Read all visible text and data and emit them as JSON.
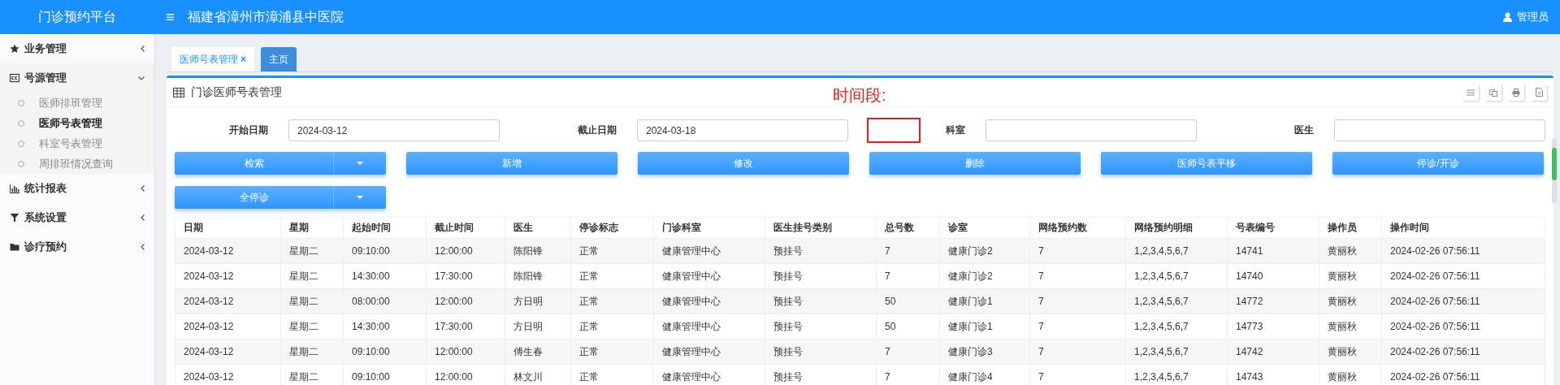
{
  "header": {
    "app_title": "门诊预约平台",
    "menu_glyph": "≡",
    "hospital": "福建省漳州市漳浦县中医院",
    "user": "管理员"
  },
  "sidebar": {
    "items": [
      {
        "label": "业务管理",
        "expanded": false
      },
      {
        "label": "号源管理",
        "expanded": true,
        "children": [
          {
            "label": "医师排班管理",
            "selected": false
          },
          {
            "label": "医师号表管理",
            "selected": true
          },
          {
            "label": "科室号表管理",
            "selected": false
          },
          {
            "label": "周排班情况查询",
            "selected": false
          }
        ]
      },
      {
        "label": "统计报表",
        "expanded": false
      },
      {
        "label": "系统设置",
        "expanded": false
      },
      {
        "label": "诊疗预约",
        "expanded": false
      }
    ]
  },
  "tabs": [
    {
      "label": "医师号表管理",
      "close": "×",
      "selected": true
    },
    {
      "label": "主页",
      "selected": false
    }
  ],
  "panel": {
    "title": "门诊医师号表管理",
    "filters": [
      {
        "label": "开始日期",
        "value": "2024-03-12"
      },
      {
        "label": "截止日期",
        "value": "2024-03-18"
      },
      {
        "label": "科室"
      },
      {
        "label": "医生"
      }
    ],
    "annotation": "时间段:",
    "buttons": [
      {
        "label": "检索",
        "kind": "split"
      },
      {
        "label": "新增",
        "kind": "plain"
      },
      {
        "label": "修改",
        "kind": "plain"
      },
      {
        "label": "删除",
        "kind": "plain"
      },
      {
        "label": "医师号表平移",
        "kind": "plain"
      },
      {
        "label": "停诊/开诊",
        "kind": "plain"
      },
      {
        "label": "全停诊",
        "kind": "split"
      }
    ],
    "table": {
      "columns": [
        "日期",
        "星期",
        "起始时间",
        "截止时间",
        "医生",
        "停诊标志",
        "门诊科室",
        "医生挂号类别",
        "总号数",
        "诊室",
        "网络预约数",
        "网络预约明细",
        "号表编号",
        "操作员",
        "操作时间"
      ],
      "rows": [
        [
          "2024-03-12",
          "星期二",
          "09:10:00",
          "12:00:00",
          "陈阳锋",
          "正常",
          "健康管理中心",
          "预挂号",
          "7",
          "健康门诊2",
          "7",
          "1,2,3,4,5,6,7",
          "14741",
          "黄丽秋",
          "2024-02-26 07:56:11"
        ],
        [
          "2024-03-12",
          "星期二",
          "14:30:00",
          "17:30:00",
          "陈阳锋",
          "正常",
          "健康管理中心",
          "预挂号",
          "7",
          "健康门诊2",
          "7",
          "1,2,3,4,5,6,7",
          "14740",
          "黄丽秋",
          "2024-02-26 07:56:11"
        ],
        [
          "2024-03-12",
          "星期二",
          "08:00:00",
          "12:00:00",
          "方日明",
          "正常",
          "健康管理中心",
          "预挂号",
          "50",
          "健康门诊1",
          "7",
          "1,2,3,4,5,6,7",
          "14772",
          "黄丽秋",
          "2024-02-26 07:56:11"
        ],
        [
          "2024-03-12",
          "星期二",
          "14:30:00",
          "17:30:00",
          "方日明",
          "正常",
          "健康管理中心",
          "预挂号",
          "50",
          "健康门诊1",
          "7",
          "1,2,3,4,5,6,7",
          "14773",
          "黄丽秋",
          "2024-02-26 07:56:11"
        ],
        [
          "2024-03-12",
          "星期二",
          "09:10:00",
          "12:00:00",
          "傅生春",
          "正常",
          "健康管理中心",
          "预挂号",
          "7",
          "健康门诊3",
          "7",
          "1,2,3,4,5,6,7",
          "14742",
          "黄丽秋",
          "2024-02-26 07:56:11"
        ],
        [
          "2024-03-12",
          "星期二",
          "09:10:00",
          "12:00:00",
          "林文川",
          "正常",
          "健康管理中心",
          "预挂号",
          "7",
          "健康门诊4",
          "7",
          "1,2,3,4,5,6,7",
          "14743",
          "黄丽秋",
          "2024-02-26 07:56:11"
        ]
      ]
    }
  }
}
